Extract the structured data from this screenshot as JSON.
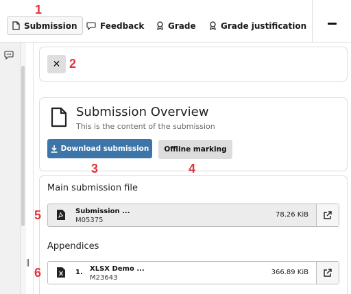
{
  "tabs": [
    {
      "label": "Submission",
      "icon": "document-icon",
      "active": true
    },
    {
      "label": "Feedback",
      "icon": "speech-bubble-icon",
      "active": false
    },
    {
      "label": "Grade",
      "icon": "award-icon",
      "active": false
    },
    {
      "label": "Grade justification",
      "icon": "award-icon",
      "active": false
    }
  ],
  "overview": {
    "title": "Submission Overview",
    "subtitle": "This is the content of the submission",
    "download_label": "Download submission",
    "offline_label": "Offline marking"
  },
  "main_file": {
    "heading": "Main submission file",
    "name": "Submission ...",
    "id": "M05375",
    "size": "78.26 KiB"
  },
  "appendices": {
    "heading": "Appendices",
    "items": [
      {
        "number": "1.",
        "name": "XLSX Demo ...",
        "id": "M23643",
        "size": "366.89 KiB"
      }
    ]
  },
  "markers": [
    "1",
    "2",
    "3",
    "4",
    "5",
    "6"
  ],
  "colors": {
    "accent": "#3d75a8",
    "marker": "#e5333c"
  }
}
